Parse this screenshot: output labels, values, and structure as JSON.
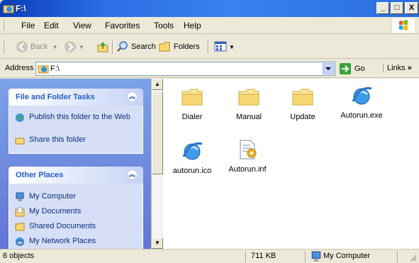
{
  "window": {
    "title": "F:\\",
    "minimize": "_",
    "maximize": "□",
    "close": "X"
  },
  "menu": [
    "File",
    "Edit",
    "View",
    "Favorites",
    "Tools",
    "Help"
  ],
  "toolbar": {
    "back": "Back",
    "search": "Search",
    "folders": "Folders"
  },
  "address": {
    "label": "Address",
    "value": "F:\\",
    "go": "Go",
    "links": "Links"
  },
  "tasks_panel": {
    "title": "File and Folder Tasks",
    "items": [
      "Publish this folder to the Web",
      "Share this folder"
    ]
  },
  "places_panel": {
    "title": "Other Places",
    "items": [
      "My Computer",
      "My Documents",
      "Shared Documents",
      "My Network Places"
    ]
  },
  "files": [
    {
      "name": "Dialer",
      "icon": "folder-icon"
    },
    {
      "name": "Manual",
      "icon": "folder-icon"
    },
    {
      "name": "Update",
      "icon": "folder-icon"
    },
    {
      "name": "Autorun.exe",
      "icon": "ie-globe-icon"
    },
    {
      "name": "autorun.ico",
      "icon": "ie-globe-icon"
    },
    {
      "name": "Autorun.inf",
      "icon": "settings-file-icon"
    }
  ],
  "status": {
    "objects": "6 objects",
    "size": "711 KB",
    "location": "My Computer"
  },
  "colors": {
    "titlebar": "#2b6fe4",
    "taskpane": "#7ba2e7",
    "task_link": "#0c2f7c",
    "panel_title": "#215dc6"
  }
}
